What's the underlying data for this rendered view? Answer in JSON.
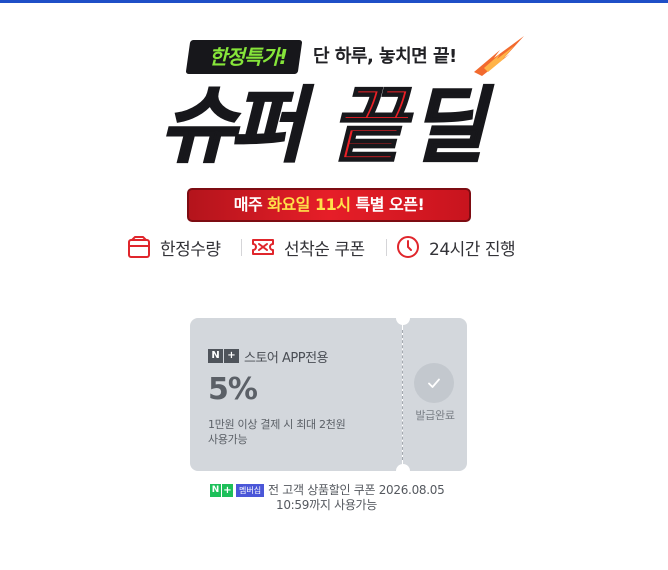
{
  "banner": {
    "tag": "한정특가!",
    "slogan": "단 하루, 놓치면 끝!",
    "title": {
      "part1": "슈퍼",
      "part2": "끝",
      "part3": "딜"
    },
    "weekly": {
      "prefix": "매주 ",
      "highlight": "화요일 11시",
      "suffix": " 특별 오픈!"
    },
    "features": [
      {
        "icon": "box-icon",
        "label": "한정수량"
      },
      {
        "icon": "coupon-icon",
        "label": "선착순 쿠폰"
      },
      {
        "icon": "clock-icon",
        "label": "24시간 진행"
      }
    ],
    "colors": {
      "accent_red": "#ec2026",
      "tag_green": "#86e53a",
      "highlight_yellow": "#ffe14a"
    }
  },
  "coupon": {
    "badge_n": "N",
    "badge_plus": "+",
    "store_label": "스토어 APP전용",
    "discount": "5%",
    "condition_line1": "1만원 이상 결제 시 최대 2천원",
    "condition_line2": "사용가능",
    "status": "발급완료",
    "colors": {
      "background": "#d3d7dc"
    }
  },
  "note": {
    "badge_n": "N",
    "badge_plus": "+",
    "badge_text": "멤버십",
    "line1": "전 고객 상품할인 쿠폰 2026.08.05",
    "line2": "10:59까지 사용가능",
    "colors": {
      "badge_green": "#1dc05a",
      "badge_blue": "#4b57d8"
    }
  }
}
